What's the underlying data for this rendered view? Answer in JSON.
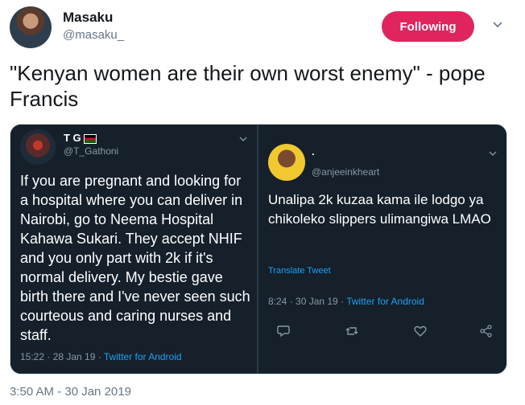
{
  "author": {
    "name": "Masaku",
    "handle": "@masaku_",
    "avatar_icon": "profile-photo"
  },
  "follow_button": {
    "label": "Following",
    "color": "#e0245e"
  },
  "menu_icon": "chevron-down-icon",
  "tweet": {
    "text": "\"Kenyan women are their own worst enemy\" - pope Francis",
    "timestamp": "3:50 AM - 30 Jan 2019"
  },
  "media": {
    "left": {
      "name": "T G",
      "name_icon": "kenya-flag-icon",
      "handle": "@T_Gathoni",
      "text": "If you are pregnant and looking for a hospital where you can deliver in Nairobi, go to Neema Hospital Kahawa Sukari. They accept NHIF and you only part with 2k if it's normal delivery. My bestie gave birth there and I've never seen such courteous and caring nurses and staff.",
      "time": "15:22 · 28 Jan 19 · ",
      "app": "Twitter for Android"
    },
    "right": {
      "name": ".",
      "handle": "@anjeeinkheart",
      "text": "Unalipa 2k kuzaa kama ile lodgo ya chikoleko slippers ulimangiwa LMAO",
      "translate": "Translate Tweet",
      "time": "8:24 · 30 Jan 19 · ",
      "app": "Twitter for Android",
      "actions": [
        "reply-icon",
        "retweet-icon",
        "like-icon",
        "share-icon"
      ]
    }
  },
  "colors": {
    "link": "#1da1f2",
    "dark_bg": "#15202b",
    "muted": "#657786"
  }
}
